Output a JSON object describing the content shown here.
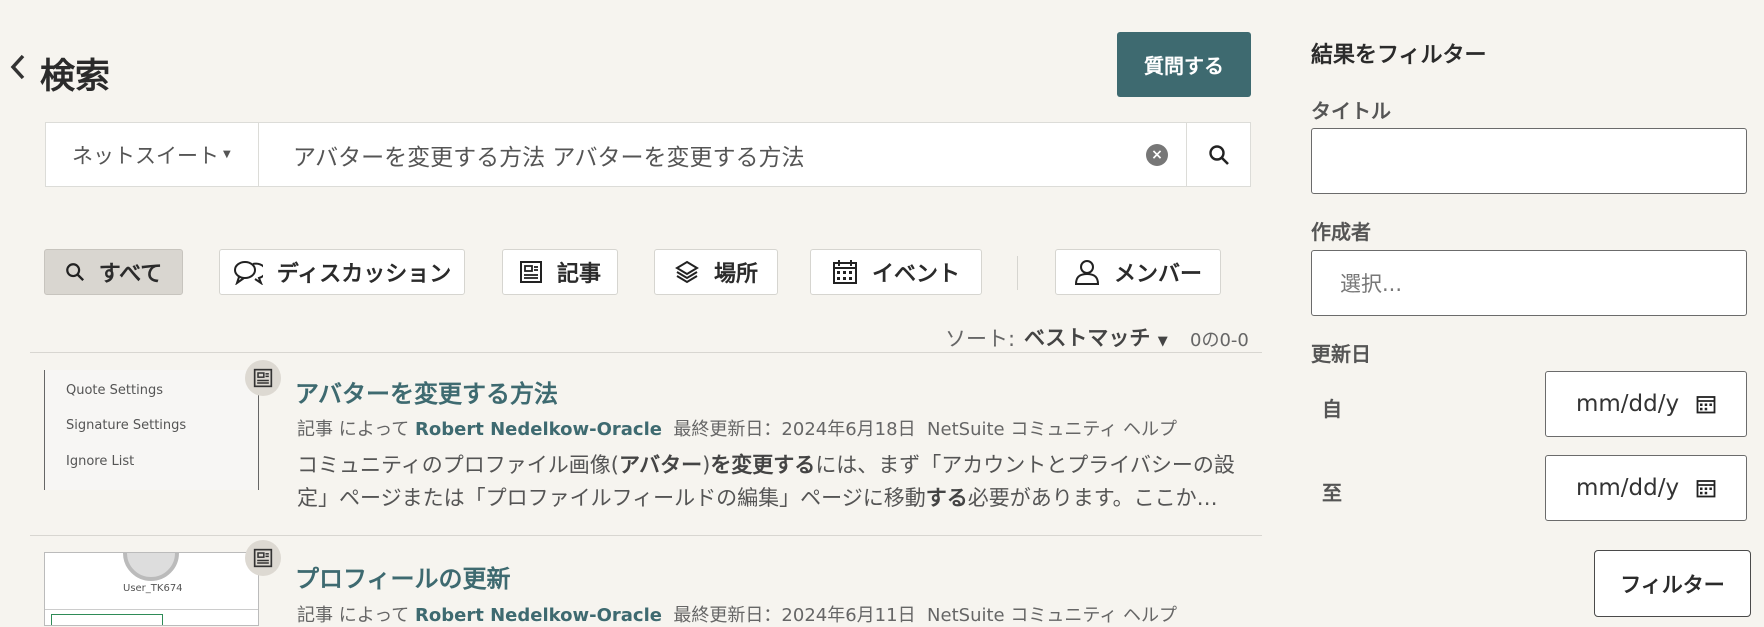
{
  "header": {
    "title": "検索",
    "ask_button": "質問する"
  },
  "search": {
    "scope": "ネットスイート",
    "query": "アバターを変更する方法 アバターを変更する方法",
    "clear_label": "×"
  },
  "tabs": [
    {
      "label": "すべて",
      "icon": "search-icon",
      "active": true
    },
    {
      "label": "ディスカッション",
      "icon": "discussion-icon"
    },
    {
      "label": "記事",
      "icon": "article-icon"
    },
    {
      "label": "場所",
      "icon": "layers-icon"
    },
    {
      "label": "イベント",
      "icon": "calendar-icon"
    },
    {
      "label": "メンバー",
      "icon": "user-icon"
    }
  ],
  "sort": {
    "label": "ソート:",
    "value": "ベストマッチ",
    "count": "0の0-0"
  },
  "results": [
    {
      "title": "アバターを変更する方法",
      "type": "記事",
      "by": "によって",
      "author": "Robert Nedelkow-Oracle",
      "updated": "最終更新日：2024年6月18日",
      "place": "NetSuite コミュニティ ヘルプ",
      "thumb_lines": [
        "Quote Settings",
        "Signature Settings",
        "Ignore List"
      ],
      "snippet": {
        "p1": "コミュニティのプロファイル画像(",
        "b1": "アバター",
        "p2": ")",
        "b2": "を変更する",
        "p3": "には、まず「アカウントとプライバシーの設定」ページまたは「プロファイルフィールドの編集」ページに移動",
        "b3": "する",
        "p4": "必要があります。ここか…"
      }
    },
    {
      "title": "プロフィールの更新",
      "type": "記事",
      "by": "によって",
      "author": "Robert Nedelkow-Oracle",
      "updated": "最終更新日：2024年6月11日",
      "place": "NetSuite コミュニティ ヘルプ",
      "thumb_user": "User_TK674"
    }
  ],
  "filters": {
    "heading": "結果をフィルター",
    "title_label": "タイトル",
    "author_label": "作成者",
    "author_placeholder": "選択...",
    "updated_label": "更新日",
    "from_label": "自",
    "to_label": "至",
    "date_placeholder": "mm/dd/y",
    "apply_button": "フィルター"
  },
  "colors": {
    "accent": "#3e6a70",
    "background": "#f6f4ef"
  }
}
